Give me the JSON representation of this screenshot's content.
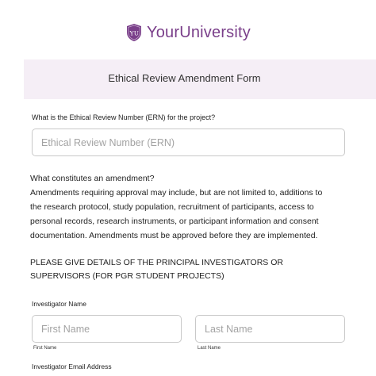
{
  "brand": {
    "logo_text": "YourUniversity",
    "shield_initials": "YU",
    "accent_color": "#7a3f8a"
  },
  "header": {
    "title": "Ethical Review Amendment Form",
    "band_color": "#f5eef6"
  },
  "ern": {
    "label": "What is the Ethical Review Number (ERN) for the project?",
    "placeholder": "Ethical Review Number (ERN)",
    "value": ""
  },
  "amendment_info": {
    "lines": [
      "What constitutes an amendment?",
      "Amendments requiring approval may include, but are not limited to, additions to",
      "the research protocol, study population, recruitment of participants, access to",
      "personal records, research instruments, or participant information and consent",
      "documentation.  Amendments must be approved before they are implemented."
    ]
  },
  "pi_section": {
    "lines": [
      "PLEASE GIVE DETAILS OF THE PRINCIPAL INVESTIGATORS OR",
      "SUPERVISORS (FOR PGR STUDENT PROJECTS)"
    ]
  },
  "investigator_name": {
    "label": "Investigator Name",
    "first": {
      "placeholder": "First Name",
      "sublabel": "First Name",
      "value": ""
    },
    "last": {
      "placeholder": "Last Name",
      "sublabel": "Last Name",
      "value": ""
    }
  },
  "investigator_email": {
    "label": "Investigator Email Address"
  }
}
